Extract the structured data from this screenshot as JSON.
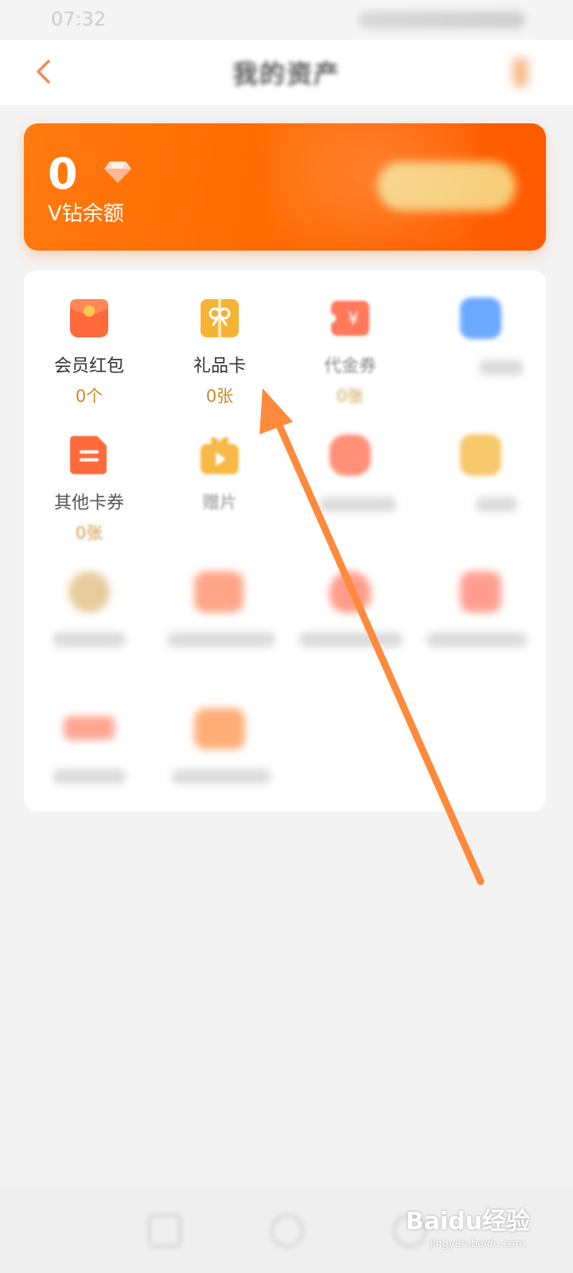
{
  "status_bar": {
    "time": "07:32"
  },
  "header": {
    "title": "我的资产"
  },
  "balance": {
    "amount": "0",
    "label": "V钻余额"
  },
  "assets": [
    {
      "label": "会员红包",
      "count": "0个",
      "icon": "red-envelope-icon",
      "color": "#ff6a3c"
    },
    {
      "label": "礼品卡",
      "count": "0张",
      "icon": "gift-card-icon",
      "color": "#f7b334"
    },
    {
      "label": "代金券",
      "count": "0张",
      "icon": "coupon-icon",
      "color": "#ff6b4a"
    },
    {
      "label": "",
      "count": "",
      "icon": "blue-card-icon",
      "color": "#3a8dff"
    },
    {
      "label": "其他卡券",
      "count": "0张",
      "icon": "ticket-icon",
      "color": "#ff6a3c"
    },
    {
      "label": "赠片",
      "count": "",
      "icon": "video-gift-icon",
      "color": "#f7b334"
    },
    {
      "label": "",
      "count": "",
      "icon": "bag-icon",
      "color": "#ff6b4a"
    },
    {
      "label": "",
      "count": "",
      "icon": "yellow-card-icon",
      "color": "#f5b63c"
    },
    {
      "label": "",
      "count": "",
      "icon": "round-icon",
      "color": "#d7a95a"
    },
    {
      "label": "",
      "count": "",
      "icon": "orange-icon",
      "color": "#ff6b3a"
    },
    {
      "label": "",
      "count": "",
      "icon": "heart-icon",
      "color": "#ff5a3a"
    },
    {
      "label": "",
      "count": "",
      "icon": "cart-icon",
      "color": "#ff5f48"
    },
    {
      "label": "",
      "count": "",
      "icon": "ticket-strip-icon",
      "color": "#ff6b4a"
    },
    {
      "label": "",
      "count": "",
      "icon": "orange-box-icon",
      "color": "#ff7a20"
    }
  ],
  "watermark": {
    "brand": "Baidu经验",
    "url": "jingyan.baidu.com"
  },
  "colors": {
    "accent": "#ff6a00",
    "annotation_arrow": "#ff8a3c",
    "count_text": "#c98a2a"
  }
}
